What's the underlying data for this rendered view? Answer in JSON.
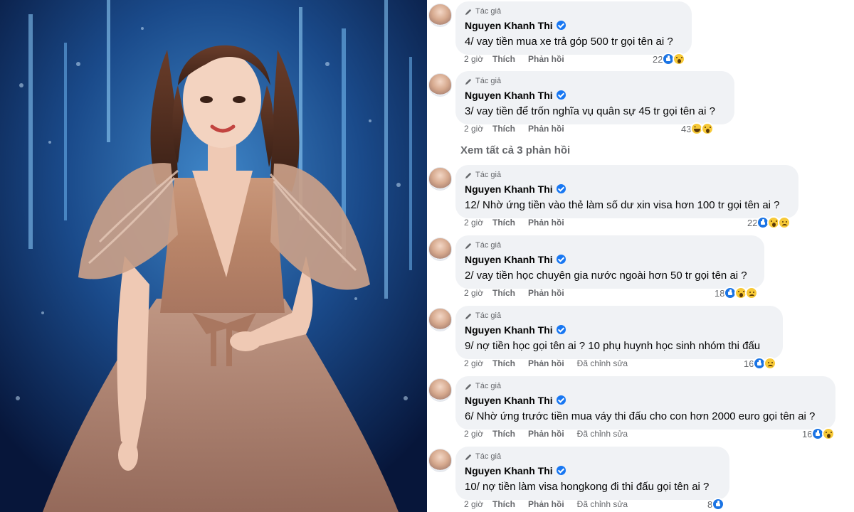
{
  "comments": [
    {
      "badge": "Tác giả",
      "name": "Nguyen Khanh Thi",
      "text": "4/ vay tiền mua xe trả góp 500 tr gọi tên ai ?",
      "time": "2 giờ",
      "like": "Thích",
      "reply": "Phản hồi",
      "edited": "",
      "reaction_count": "22",
      "reactions": [
        "like",
        "wow"
      ]
    },
    {
      "badge": "Tác giả",
      "name": "Nguyen Khanh Thi",
      "text": "3/ vay tiền để trốn nghĩa vụ quân sự 45 tr gọi tên ai ?",
      "time": "2 giờ",
      "like": "Thích",
      "reply": "Phản hồi",
      "edited": "",
      "reaction_count": "43",
      "reactions": [
        "haha",
        "wow"
      ]
    },
    {
      "badge": "Tác giả",
      "name": "Nguyen Khanh Thi",
      "text": "12/ Nhờ ứng tiền vào thẻ làm số dư xin visa hơn 100 tr gọi tên ai ?",
      "time": "2 giờ",
      "like": "Thích",
      "reply": "Phản hồi",
      "edited": "",
      "reaction_count": "22",
      "reactions": [
        "like",
        "wow",
        "sad"
      ]
    },
    {
      "badge": "Tác giả",
      "name": "Nguyen Khanh Thi",
      "text": "2/ vay tiền học chuyên gia nước ngoài hơn 50 tr gọi tên ai ?",
      "time": "2 giờ",
      "like": "Thích",
      "reply": "Phản hồi",
      "edited": "",
      "reaction_count": "18",
      "reactions": [
        "like",
        "wow",
        "sad"
      ]
    },
    {
      "badge": "Tác giả",
      "name": "Nguyen Khanh Thi",
      "text": "9/ nợ tiền học gọi tên ai ? 10 phụ huynh học sinh nhóm thi đấu",
      "time": "2 giờ",
      "like": "Thích",
      "reply": "Phản hồi",
      "edited": "Đã chỉnh sửa",
      "reaction_count": "16",
      "reactions": [
        "like",
        "sad"
      ]
    },
    {
      "badge": "Tác giả",
      "name": "Nguyen Khanh Thi",
      "text": "6/ Nhờ ứng trước tiền mua váy thi đấu cho con hơn 2000 euro gọi tên ai ?",
      "time": "2 giờ",
      "like": "Thích",
      "reply": "Phản hồi",
      "edited": "Đã chỉnh sửa",
      "reaction_count": "16",
      "reactions": [
        "like",
        "wow"
      ]
    },
    {
      "badge": "Tác giả",
      "name": "Nguyen Khanh Thi",
      "text": "10/ nợ tiền làm visa hongkong đi thi đấu gọi tên ai ?",
      "time": "2 giờ",
      "like": "Thích",
      "reply": "Phản hồi",
      "edited": "Đã chỉnh sửa",
      "reaction_count": "8",
      "reactions": [
        "like"
      ]
    }
  ],
  "view_all_replies": "Xem tất cả 3 phản hồi",
  "colors": {
    "bubble": "#f0f2f5",
    "verified": "#1877f2",
    "meta": "#65676b",
    "like": "#1b74e4",
    "emoji": "#f7c937"
  }
}
